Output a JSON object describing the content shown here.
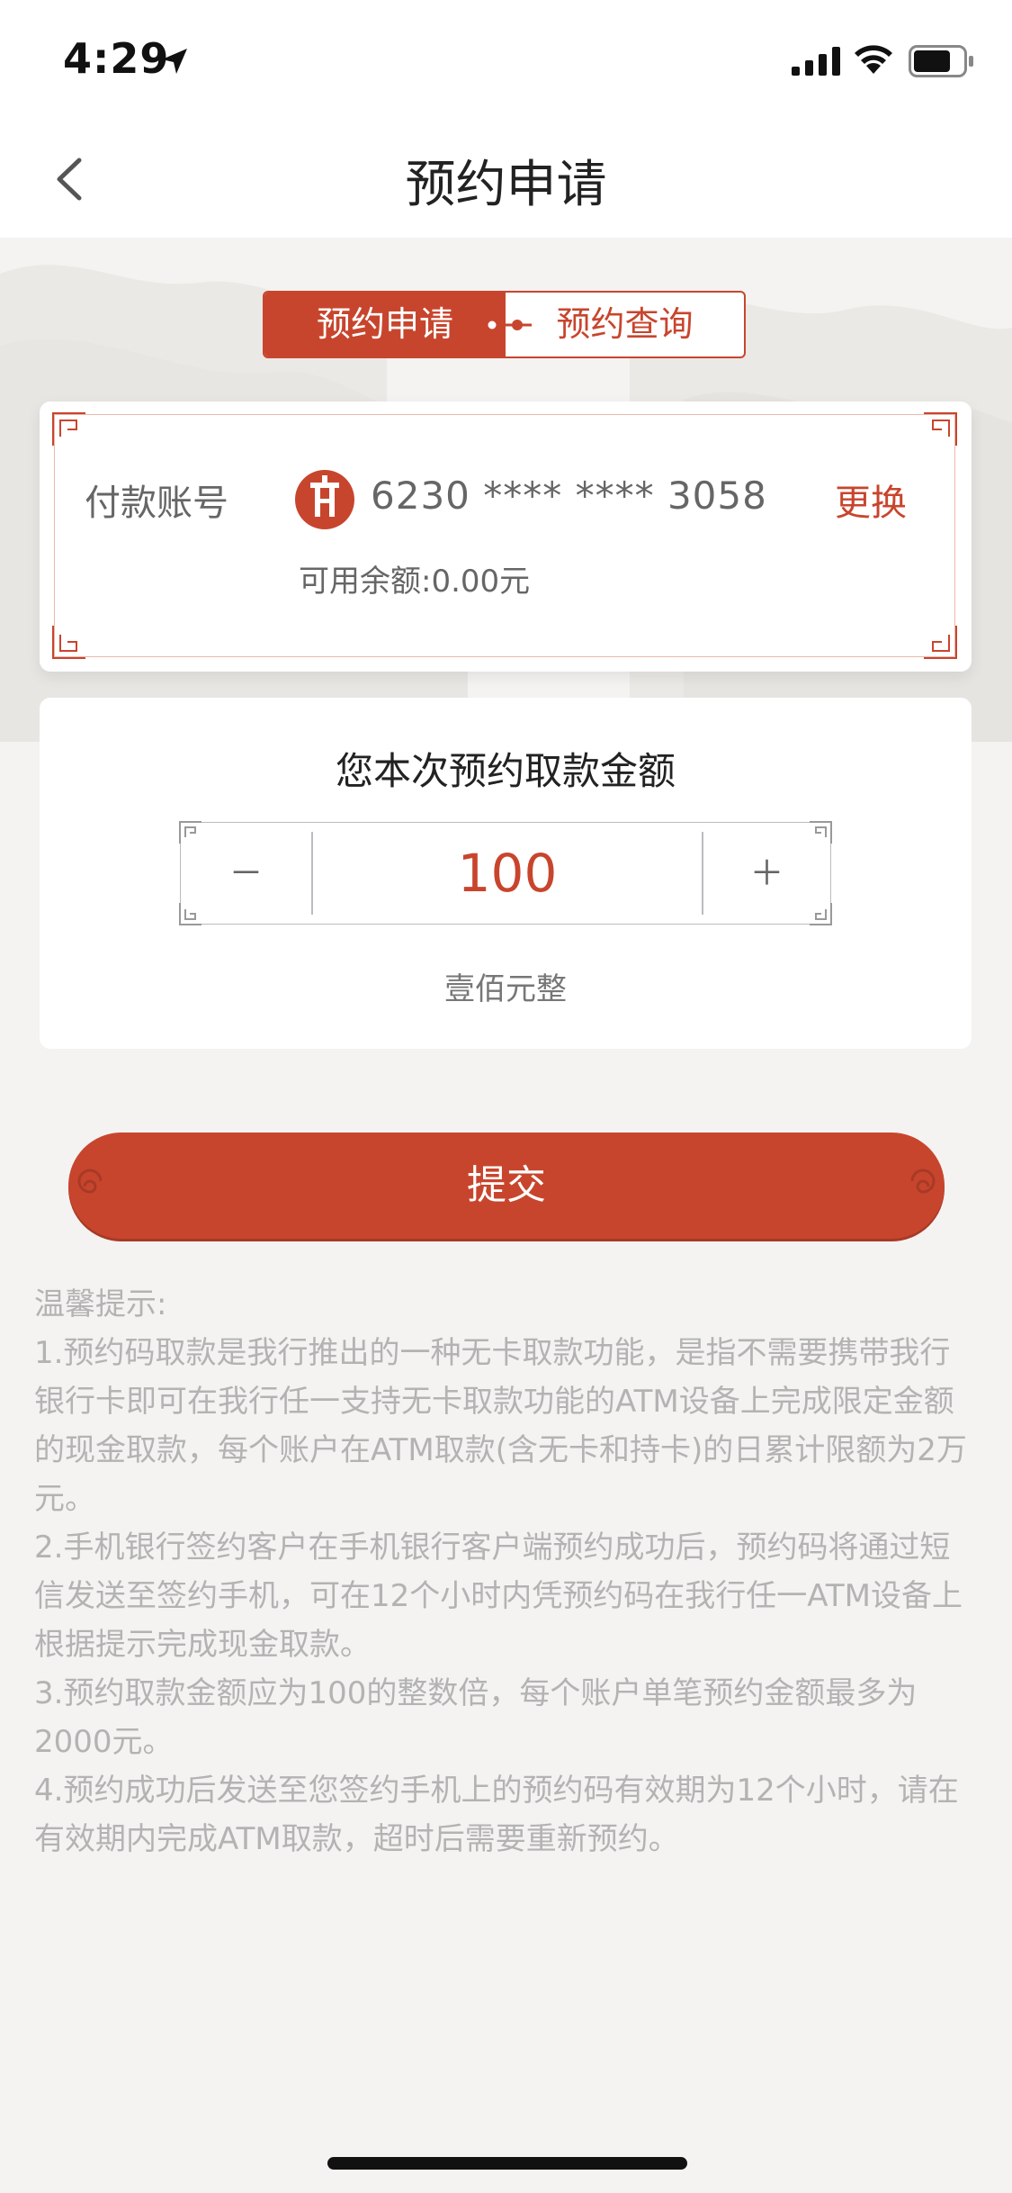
{
  "status_bar": {
    "time": "4:29"
  },
  "nav": {
    "title": "预约申请"
  },
  "tabs": {
    "apply": "预约申请",
    "query": "预约查询"
  },
  "account": {
    "label": "付款账号",
    "number": "6230 **** **** 3058",
    "change": "更换",
    "balance": "可用余额:0.00元"
  },
  "amount": {
    "title": "您本次预约取款金额",
    "minus": "－",
    "value": "100",
    "plus": "＋",
    "in_words": "壹佰元整"
  },
  "submit": {
    "label": "提交"
  },
  "tips": {
    "title": "温馨提示:",
    "items": [
      "1.预约码取款是我行推出的一种无卡取款功能，是指不需要携带我行银行卡即可在我行任一支持无卡取款功能的ATM设备上完成限定金额的现金取款，每个账户在ATM取款(含无卡和持卡)的日累计限额为2万元。",
      "2.手机银行签约客户在手机银行客户端预约成功后，预约码将通过短信发送至签约手机，可在12个小时内凭预约码在我行任一ATM设备上根据提示完成现金取款。",
      "3.预约取款金额应为100的整数倍，每个账户单笔预约金额最多为2000元。",
      "4.预约成功后发送至您签约手机上的预约码有效期为12个小时，请在有效期内完成ATM取款，超时后需要重新预约。"
    ]
  },
  "colors": {
    "brand_red": "#c8452d",
    "text_gray": "#666666",
    "tips_gray": "#b3b3b3"
  },
  "icons": [
    "location-arrow-icon",
    "cellular-signal-icon",
    "wifi-icon",
    "battery-icon",
    "back-chevron-icon",
    "bank-logo-icon"
  ]
}
